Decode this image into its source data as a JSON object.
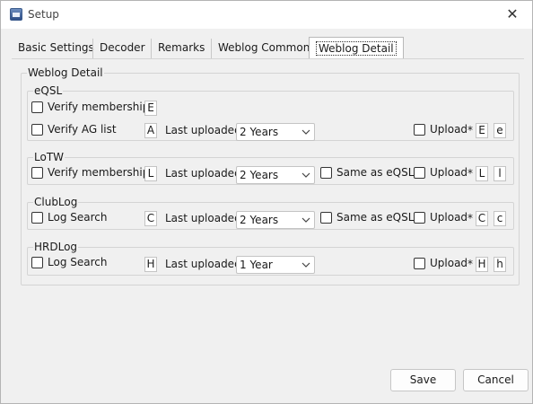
{
  "window": {
    "title": "Setup",
    "close_glyph": "✕"
  },
  "tabs": [
    {
      "label": "Basic Settings"
    },
    {
      "label": "Decoder"
    },
    {
      "label": "Remarks"
    },
    {
      "label": "Weblog Common"
    },
    {
      "label": "Weblog Detail"
    }
  ],
  "panel": {
    "group_title": "Weblog Detail",
    "last_uploaded_label": "Last uploaded",
    "same_as_eqsl_label": "Same as eQSL",
    "upload_label": "Upload",
    "asterisk": "*",
    "eqsl": {
      "title": "eQSL",
      "verify_membership": {
        "label": "Verify membership",
        "checked": false,
        "key": "E"
      },
      "verify_ag_list": {
        "label": "Verify AG list",
        "checked": false,
        "key": "A"
      },
      "last_uploaded": "2 Years",
      "upload": {
        "checked": false,
        "key1": "E",
        "key2": "e"
      }
    },
    "lotw": {
      "title": "LoTW",
      "verify_membership": {
        "label": "Verify membership",
        "checked": false,
        "key": "L"
      },
      "last_uploaded": "2 Years",
      "same_as_eqsl_checked": false,
      "upload": {
        "checked": false,
        "key1": "L",
        "key2": "l"
      }
    },
    "clublog": {
      "title": "ClubLog",
      "log_search": {
        "label": "Log Search",
        "checked": false,
        "key": "C"
      },
      "last_uploaded": "2 Years",
      "same_as_eqsl_checked": false,
      "upload": {
        "checked": false,
        "key1": "C",
        "key2": "c"
      }
    },
    "hrdlog": {
      "title": "HRDLog",
      "log_search": {
        "label": "Log Search",
        "checked": false,
        "key": "H"
      },
      "last_uploaded": "1 Year",
      "upload": {
        "checked": false,
        "key1": "H",
        "key2": "h"
      }
    }
  },
  "buttons": {
    "save": "Save",
    "cancel": "Cancel"
  }
}
